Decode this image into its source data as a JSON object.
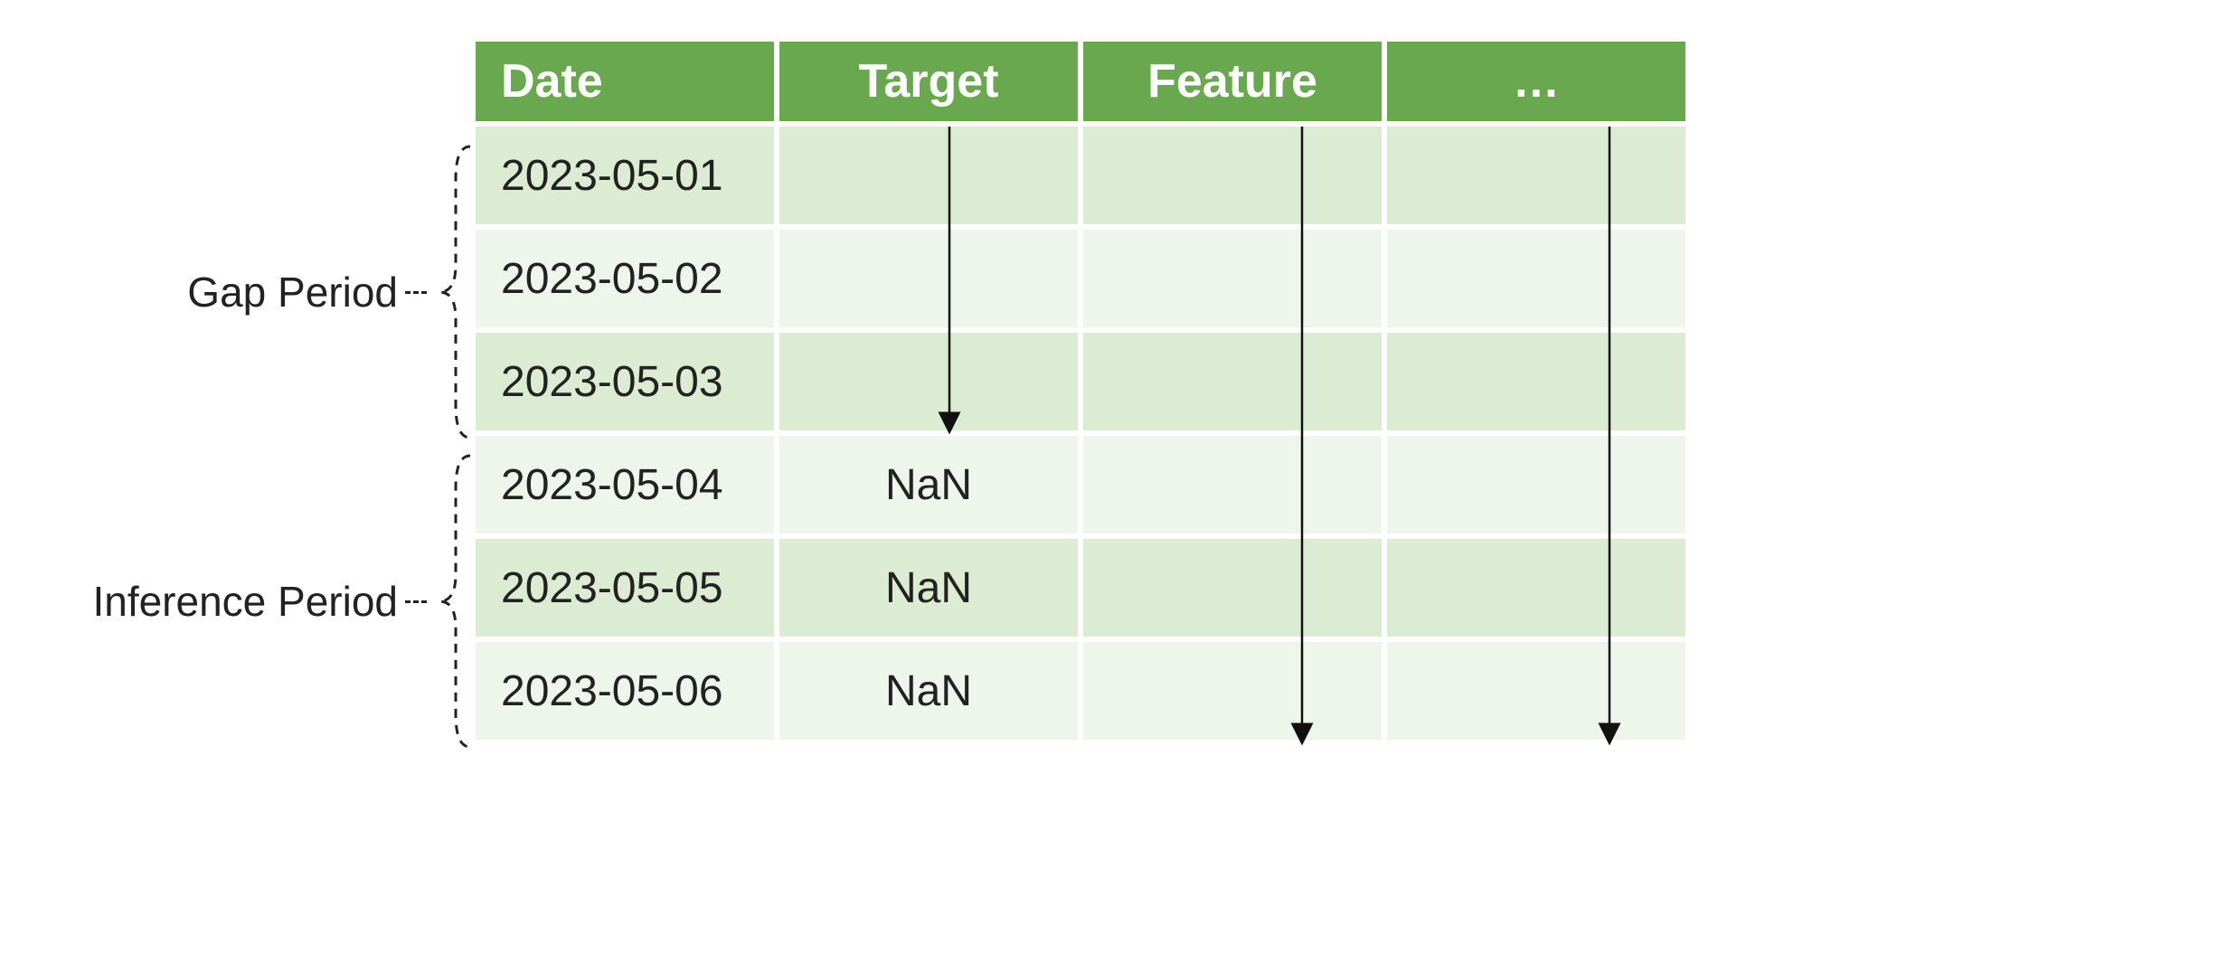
{
  "headers": {
    "date": "Date",
    "target": "Target",
    "feature": "Feature",
    "more": "…"
  },
  "labels": {
    "gap": "Gap Period",
    "inference": "Inference Period"
  },
  "rows": [
    {
      "date": "2023-05-01",
      "target": "",
      "feature": "",
      "more": ""
    },
    {
      "date": "2023-05-02",
      "target": "",
      "feature": "",
      "more": ""
    },
    {
      "date": "2023-05-03",
      "target": "",
      "feature": "",
      "more": ""
    },
    {
      "date": "2023-05-04",
      "target": "NaN",
      "feature": "",
      "more": ""
    },
    {
      "date": "2023-05-05",
      "target": "NaN",
      "feature": "",
      "more": ""
    },
    {
      "date": "2023-05-06",
      "target": "NaN",
      "feature": "",
      "more": ""
    }
  ],
  "chart_data": {
    "type": "table",
    "note": "Diagram illustrating that during the Gap Period (first 3 rows) Target values flow downward (known), and become NaN during the Inference Period (last 3 rows). Feature and additional columns have values available through all rows (arrows span full height).",
    "gap_period_rows": [
      "2023-05-01",
      "2023-05-02",
      "2023-05-03"
    ],
    "inference_period_rows": [
      "2023-05-04",
      "2023-05-05",
      "2023-05-06"
    ],
    "columns": [
      "Date",
      "Target",
      "Feature",
      "…"
    ],
    "target_known_through": "2023-05-03",
    "target_nan_from": "2023-05-04"
  }
}
